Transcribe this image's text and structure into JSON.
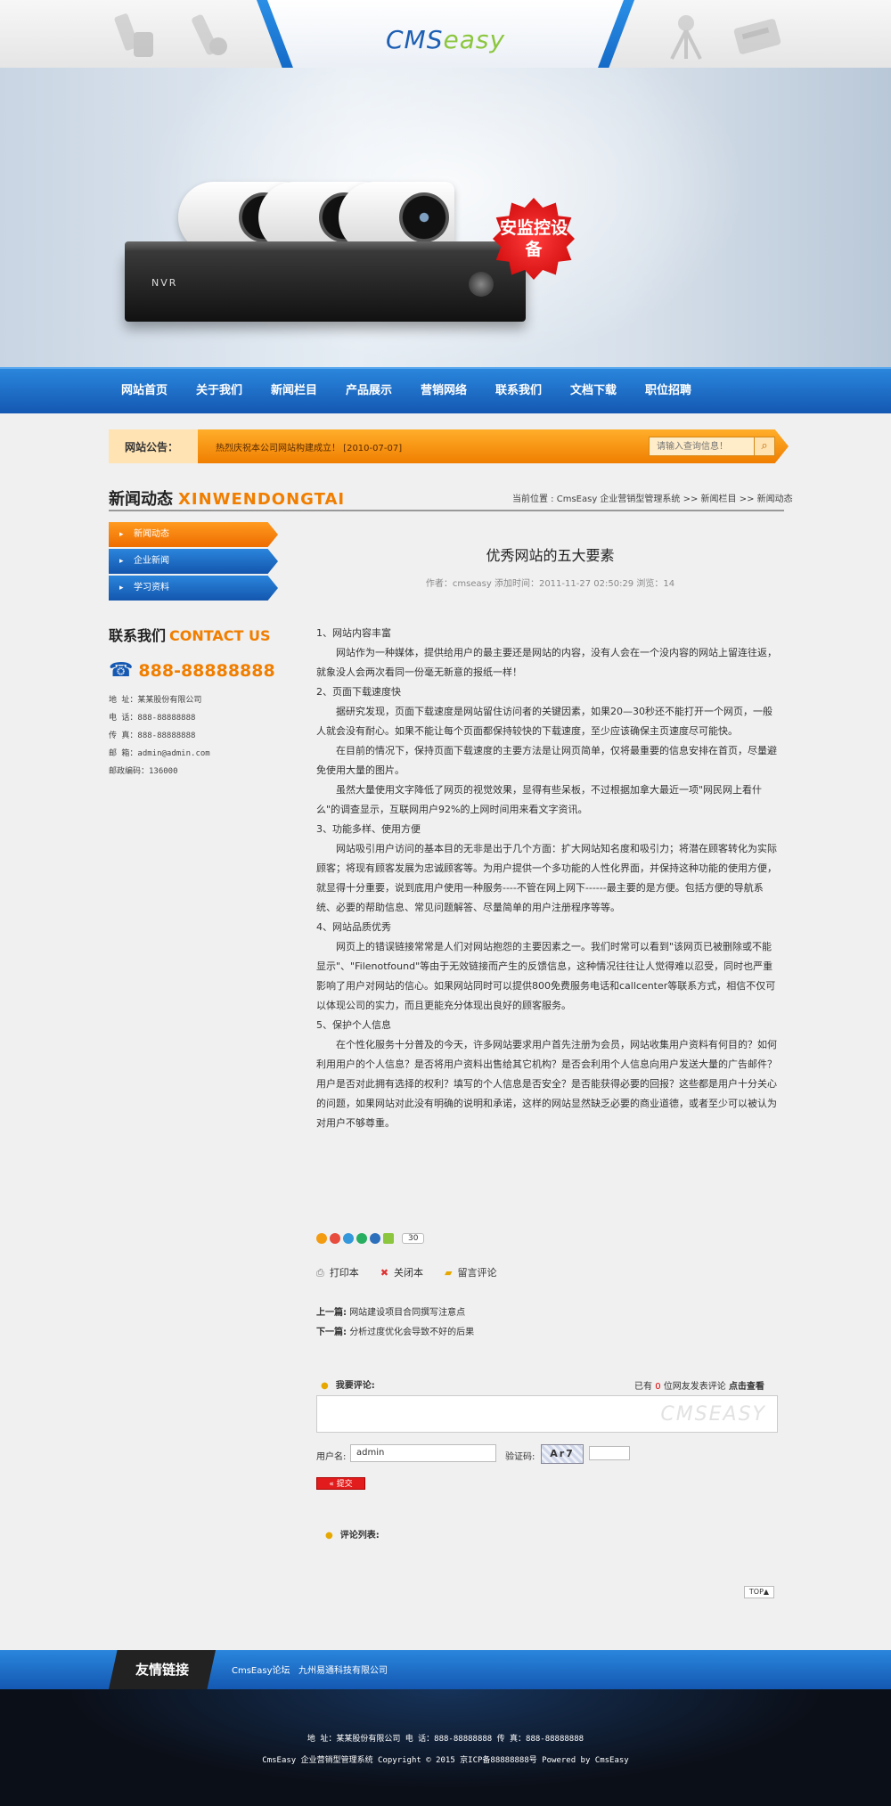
{
  "header": {
    "logo_cms": "CMS",
    "logo_easy": "easy",
    "banner_badge": "安监控设备",
    "nvr_label": "NVR"
  },
  "nav": {
    "items": [
      "网站首页",
      "关于我们",
      "新闻栏目",
      "产品展示",
      "营销网络",
      "联系我们",
      "文档下载",
      "职位招聘"
    ]
  },
  "notice": {
    "label": "网站公告：",
    "text": "热烈庆祝本公司网站构建成立！ [2010-07-07]",
    "search_placeholder": "请输入查询信息！"
  },
  "section": {
    "title_cn": "新闻动态",
    "title_en": "XINWENDONGTAI",
    "breadcrumb": "当前位置 : CmsEasy 企业营销型管理系统 >> 新闻栏目 >> 新闻动态"
  },
  "sidebar": {
    "items": [
      {
        "label": "新闻动态",
        "active": true
      },
      {
        "label": "企业新闻",
        "active": false
      },
      {
        "label": "学习资料",
        "active": false
      }
    ],
    "contact_title_cn": "联系我们",
    "contact_title_en": "CONTACT US",
    "phone": "888-88888888",
    "lines": [
      "地 址：某某股份有限公司",
      "电 话：888-88888888",
      "传 真：888-88888888",
      "邮 箱：admin@admin.com",
      "邮政编码：136000"
    ]
  },
  "article": {
    "title": "优秀网站的五大要素",
    "meta": "作者：cmseasy   添加时间：2011-11-27 02:50:29   浏览：14",
    "paragraphs": [
      {
        "text": "1、网站内容丰富",
        "indent": false
      },
      {
        "text": "网站作为一种媒体，提供给用户的最主要还是网站的内容，没有人会在一个没内容的网站上留连往返，就象没人会两次看同一份毫无新意的报纸一样！",
        "indent": true
      },
      {
        "text": "2、页面下载速度快",
        "indent": false
      },
      {
        "text": "据研究发现，页面下载速度是网站留住访问者的关键因素，如果20—30秒还不能打开一个网页，一般人就会没有耐心。如果不能让每个页面都保持较快的下载速度，至少应该确保主页速度尽可能快。",
        "indent": true
      },
      {
        "text": "在目前的情况下，保持页面下载速度的主要方法是让网页简单，仅将最重要的信息安排在首页，尽量避免使用大量的图片。",
        "indent": true
      },
      {
        "text": "虽然大量使用文字降低了网页的视觉效果，显得有些呆板，不过根据加拿大最近一项\"网民网上看什么\"的调查显示，互联网用户92%的上网时间用来看文字资讯。",
        "indent": true
      },
      {
        "text": "3、功能多样、使用方便",
        "indent": false
      },
      {
        "text": "网站吸引用户访问的基本目的无非是出于几个方面：扩大网站知名度和吸引力；将潜在顾客转化为实际顾客；将现有顾客发展为忠诚顾客等。为用户提供一个多功能的人性化界面，并保持这种功能的使用方便，就显得十分重要，说到底用户使用一种服务----不管在网上网下------最主要的是方便。包括方便的导航系统、必要的帮助信息、常见问题解答、尽量简单的用户注册程序等等。",
        "indent": true
      },
      {
        "text": "4、网站品质优秀",
        "indent": false
      },
      {
        "text": "网页上的错误链接常常是人们对网站抱怨的主要因素之一。我们时常可以看到\"该网页已被删除或不能显示\"、\"Filenotfound\"等由于无效链接而产生的反馈信息，这种情况往往让人觉得难以忍受，同时也严重影响了用户对网站的信心。如果网站同时可以提供800免费服务电话和callcenter等联系方式，相信不仅可以体现公司的实力，而且更能充分体现出良好的顾客服务。",
        "indent": true
      },
      {
        "text": "5、保护个人信息",
        "indent": false
      },
      {
        "text": "在个性化服务十分普及的今天，许多网站要求用户首先注册为会员，网站收集用户资料有何目的？如何利用用户的个人信息？是否将用户资料出售给其它机构？是否会利用个人信息向用户发送大量的广告邮件？用户是否对此拥有选择的权利？填写的个人信息是否安全？是否能获得必要的回报？这些都是用户十分关心的问题，如果网站对此没有明确的说明和承诺，这样的网站显然缺乏必要的商业道德，或者至少可以被认为对用户不够尊重。",
        "indent": true
      }
    ],
    "share_count": "30",
    "tools": {
      "print": "打印本",
      "close": "关闭本",
      "comment": "留言评论"
    },
    "prev_label": "上一篇:",
    "prev_title": "网站建设项目合同撰写注意点",
    "next_label": "下一篇:",
    "next_title": "分析过度优化会导致不好的后果"
  },
  "comment": {
    "head": "我要评论:",
    "count_prefix": "已有",
    "count": "0",
    "count_suffix": "位网友发表评论",
    "view_link": "点击查看",
    "watermark": "CMSEASY",
    "user_label": "用户名:",
    "user_value": "admin",
    "code_label": "验证码:",
    "captcha": "Ar7",
    "submit": "« 提交",
    "list_head": "评论列表:"
  },
  "top_button": "TOP▲",
  "links": {
    "label": "友情链接",
    "items": [
      "CmsEasy论坛",
      "九州易通科技有限公司"
    ]
  },
  "footer": {
    "line1": "地 址：某某股份有限公司  电 话：888-88888888  传 真：888-88888888",
    "line2": "CmsEasy 企业营销型管理系统 Copyright © 2015 京ICP备88888888号 Powered by CmsEasy"
  }
}
